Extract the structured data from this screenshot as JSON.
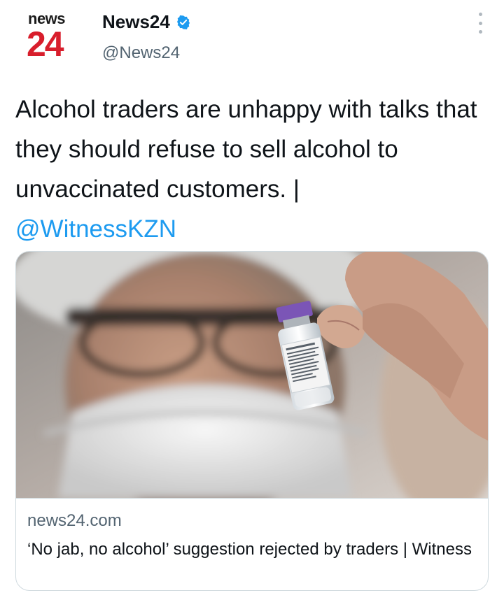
{
  "avatar": {
    "top_word": "news",
    "number": "24"
  },
  "user": {
    "display_name": "News24",
    "handle": "@News24",
    "verified": true
  },
  "tweet": {
    "text": "Alcohol traders are unhappy with talks that they should refuse to sell alcohol to unvaccinated customers. |",
    "mention": "@WitnessKZN"
  },
  "card": {
    "domain": "news24.com",
    "title": "‘No jab, no alcohol’ suggestion rejected by traders | Witness",
    "image": {
      "description": "vaccine-vial-photo",
      "vial_label_text": "Pfizer-BioNTech COVID-19 Vaccine"
    }
  },
  "icons": {
    "verified": "verified-badge-icon",
    "more": "more-options-icon"
  },
  "colors": {
    "brand_red": "#d81e2c",
    "link": "#1d9bf0",
    "secondary_text": "#536471",
    "border": "#cfd9de"
  }
}
